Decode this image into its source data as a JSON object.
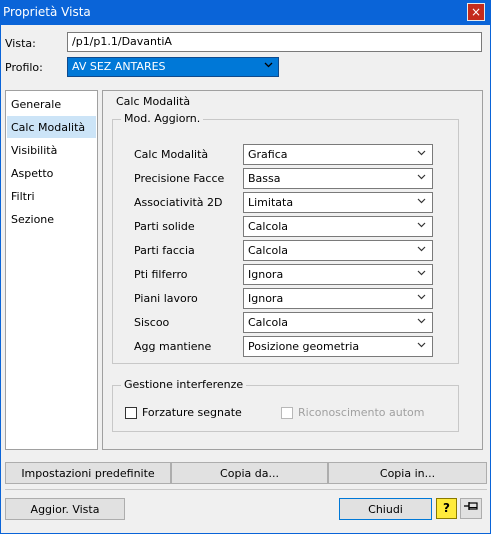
{
  "window": {
    "title": "Proprietà Vista",
    "close_glyph": "×"
  },
  "vista": {
    "label": "Vista:",
    "value": "/p1/p1.1/DavantiA"
  },
  "profilo": {
    "label": "Profilo:",
    "value": "AV SEZ ANTARES"
  },
  "sidebar": {
    "items": [
      {
        "label": "Generale"
      },
      {
        "label": "Calc Modalità",
        "selected": true
      },
      {
        "label": "Visibilità"
      },
      {
        "label": "Aspetto"
      },
      {
        "label": "Filtri"
      },
      {
        "label": "Sezione"
      }
    ]
  },
  "panel": {
    "title": "Calc Modalità",
    "mod_group": {
      "title": "Mod. Aggiorn.",
      "rows": [
        {
          "label": "Calc Modalità",
          "value": "Grafica"
        },
        {
          "label": "Precisione Facce",
          "value": "Bassa"
        },
        {
          "label": "Associatività 2D",
          "value": "Limitata"
        },
        {
          "label": "Parti solide",
          "value": "Calcola"
        },
        {
          "label": "Parti faccia",
          "value": "Calcola"
        },
        {
          "label": "Pti filferro",
          "value": "Ignora"
        },
        {
          "label": "Piani lavoro",
          "value": "Ignora"
        },
        {
          "label": "Siscoo",
          "value": "Calcola"
        },
        {
          "label": "Agg mantiene",
          "value": "Posizione geometria"
        }
      ]
    },
    "interference_group": {
      "title": "Gestione interferenze",
      "forzature": {
        "label": "Forzature segnate",
        "checked": false
      },
      "riconoscimento": {
        "label": "Riconoscimento autom",
        "checked": false,
        "disabled": true
      }
    }
  },
  "buttons": {
    "defaults": "Impostazioni predefinite",
    "copy_from": "Copia da...",
    "copy_to": "Copia in...",
    "update_view": "Aggior. Vista",
    "close": "Chiudi",
    "help_glyph": "?",
    "pin_glyph": "⊣⊐"
  },
  "icons": {
    "chevron": "chevron-down-icon",
    "help": "help-icon",
    "pin": "pin-icon"
  }
}
